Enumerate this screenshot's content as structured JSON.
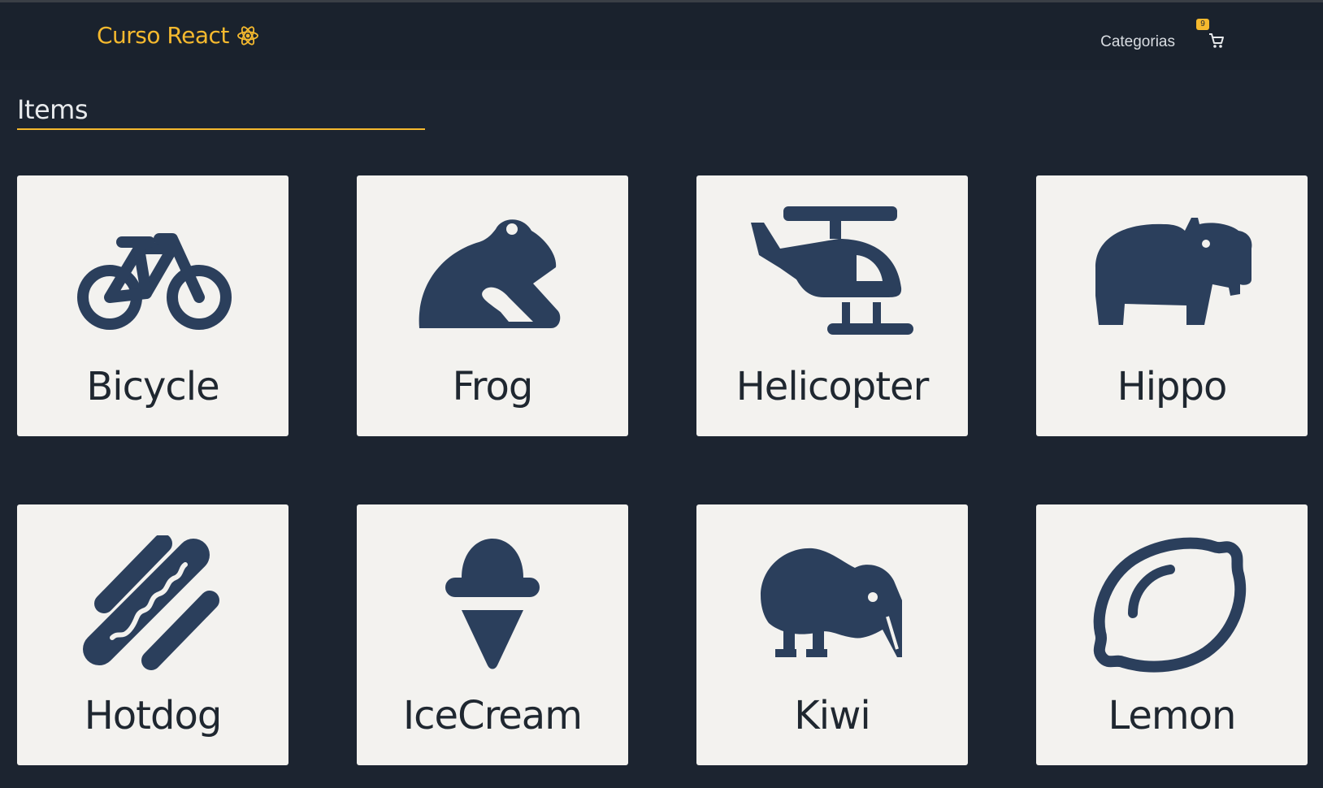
{
  "navbar": {
    "brand": "Curso React",
    "brand_icon": "react-atom-icon",
    "categories_label": "Categorias",
    "cart_count": "9",
    "cart_icon": "shopping-cart-icon"
  },
  "section": {
    "title": "Items"
  },
  "colors": {
    "background": "#1c2430",
    "accent": "#f5b92e",
    "card": "#f3f2ef",
    "icon": "#2b3f5c"
  },
  "items": [
    {
      "label": "Bicycle",
      "icon": "bicycle-icon"
    },
    {
      "label": "Frog",
      "icon": "frog-icon"
    },
    {
      "label": "Helicopter",
      "icon": "helicopter-icon"
    },
    {
      "label": "Hippo",
      "icon": "hippo-icon"
    },
    {
      "label": "Hotdog",
      "icon": "hotdog-icon"
    },
    {
      "label": "IceCream",
      "icon": "ice-cream-icon"
    },
    {
      "label": "Kiwi",
      "icon": "kiwi-bird-icon"
    },
    {
      "label": "Lemon",
      "icon": "lemon-icon"
    }
  ]
}
